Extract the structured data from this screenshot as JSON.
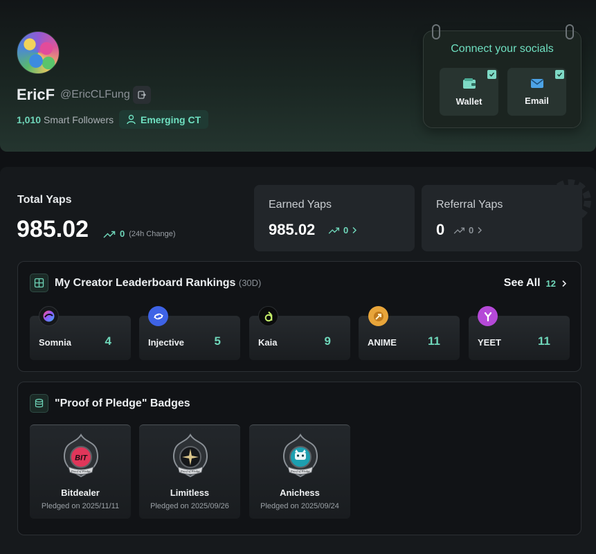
{
  "profile": {
    "name": "EricF",
    "handle": "@EricCLFung",
    "smart_followers_count": "1,010",
    "smart_followers_label": "Smart Followers",
    "tier": "Emerging CT"
  },
  "socials": {
    "title": "Connect your socials",
    "items": [
      {
        "label": "Wallet",
        "icon": "wallet-icon",
        "connected": true
      },
      {
        "label": "Email",
        "icon": "email-icon",
        "connected": true
      }
    ]
  },
  "yaps": {
    "total_label": "Total Yaps",
    "total_value": "985.02",
    "total_change": "0",
    "total_change_note": "(24h Change)",
    "earned_label": "Earned Yaps",
    "earned_value": "985.02",
    "earned_change": "0",
    "referral_label": "Referral Yaps",
    "referral_value": "0",
    "referral_change": "0"
  },
  "leaderboard": {
    "title": "My Creator Leaderboard Rankings",
    "period": "(30D)",
    "see_all_label": "See All",
    "see_all_count": "12",
    "items": [
      {
        "name": "Somnia",
        "rank": "4"
      },
      {
        "name": "Injective",
        "rank": "5"
      },
      {
        "name": "Kaia",
        "rank": "9"
      },
      {
        "name": "ANIME",
        "rank": "11"
      },
      {
        "name": "YEET",
        "rank": "11"
      }
    ]
  },
  "pledge": {
    "title": "\"Proof of Pledge\" Badges",
    "items": [
      {
        "name": "Bitdealer",
        "date": "Pledged on 2025/11/11",
        "seal": "BIT",
        "ribbon": "Proof of Pledge"
      },
      {
        "name": "Limitless",
        "date": "Pledged on 2025/09/26",
        "ribbon": "Proof of Pledge"
      },
      {
        "name": "Anichess",
        "date": "Pledged on 2025/09/24",
        "ribbon": "Proof of Pledge"
      }
    ]
  },
  "colors": {
    "accent": "#6fd6b9",
    "background": "#0f1114",
    "card": "#22262a"
  }
}
